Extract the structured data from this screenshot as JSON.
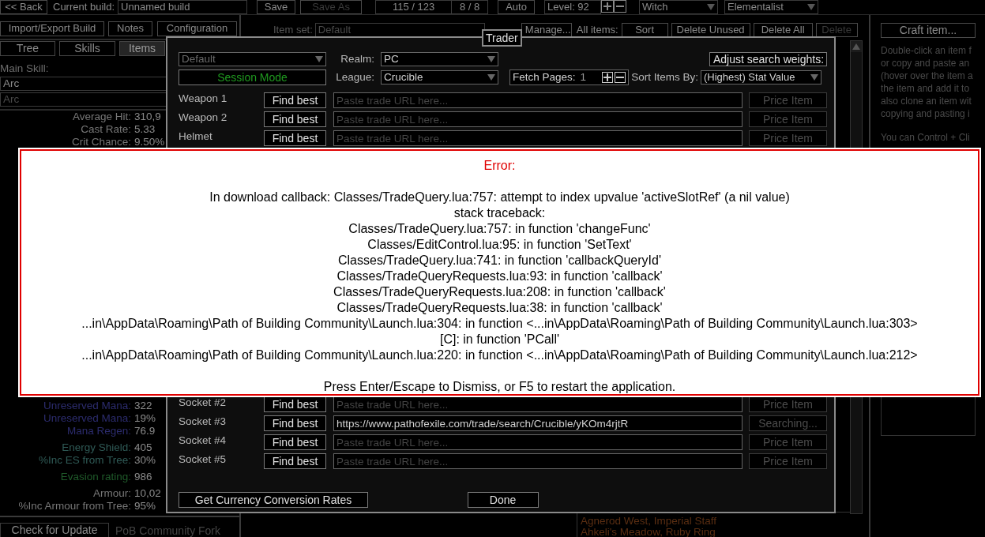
{
  "top_bar": {
    "back_button": "<< Back",
    "build_label": "Current build:",
    "build_name": "Unnamed build",
    "save_button": {
      "label": "Save",
      "disabled": false
    },
    "save_as_button": {
      "label": "Save As",
      "disabled": true
    },
    "passive_points": "115 / 123",
    "ascendancy_points": "8 / 8",
    "auto_button": "Auto",
    "level": "Level: 92",
    "class_dropdown": "Witch",
    "ascendancy_dropdown": "Elementalist"
  },
  "build_buttons": [
    "Import/Export Build",
    "Notes",
    "Configuration"
  ],
  "tabs": [
    {
      "label": "Tree",
      "selected": false
    },
    {
      "label": "Skills",
      "selected": false
    },
    {
      "label": "Items",
      "selected": true
    }
  ],
  "main_skill": {
    "label": "Main Skill:",
    "skill": {
      "value": "Arc",
      "disabled": false
    },
    "skill_part": {
      "value": "Arc",
      "disabled": true
    }
  },
  "stat_groups_upper": [
    {
      "stats": [
        {
          "label": "Average Hit:",
          "value": "310,9",
          "color": "#777777"
        },
        {
          "label": "Cast Rate:",
          "value": "5.33",
          "color": "#777777"
        },
        {
          "label": "Crit Chance:",
          "value": "9.50%",
          "color": "#777777"
        }
      ]
    }
  ],
  "stat_groups_lower": [
    {
      "stats": [
        {
          "label": "Unreserved Mana:",
          "value": "322",
          "color": "#2c2c6e"
        },
        {
          "label": "Unreserved Mana:",
          "value": "19%",
          "color": "#2c2c6e"
        },
        {
          "label": "Mana Regen:",
          "value": "76.9",
          "color": "#2c2c6e"
        }
      ]
    },
    {
      "stats": [
        {
          "label": "Energy Shield:",
          "value": "405",
          "color": "#2f5a56"
        },
        {
          "label": "%Inc ES from Tree:",
          "value": "30%",
          "color": "#2f5a56"
        }
      ]
    },
    {
      "stats": [
        {
          "label": "Evasion rating:",
          "value": "986",
          "color": "#1f5a2a"
        }
      ]
    },
    {
      "stats": [
        {
          "label": "Armour:",
          "value": "10,02",
          "color": "#777777"
        },
        {
          "label": "%Inc Armour from Tree:",
          "value": "95%",
          "color": "#777777"
        }
      ]
    }
  ],
  "footer": {
    "update_button": "Check for Update",
    "fork_label": "PoB Community Fork"
  },
  "items_toolbar": {
    "item_set_label": "Item set:",
    "item_set": "Default",
    "manage_button": "Manage...",
    "all_items_label": "All items:",
    "buttons": [
      {
        "label": "Sort",
        "disabled": false
      },
      {
        "label": "Delete Unused",
        "disabled": false
      },
      {
        "label": "Delete All",
        "disabled": false
      },
      {
        "label": "Delete",
        "disabled": true
      }
    ]
  },
  "item_list": [
    "Agnerod West, Imperial Staff",
    "Ahkeli's Meadow, Ruby Ring"
  ],
  "craft_panel": {
    "craft_button": "Craft item...",
    "help_text": [
      "Double-click an item f\nor copy and paste an\n(hover over the item a\nthe item and add it to\nalso clone an item wit\ncopying and pasting i",
      "You can Control + Cli"
    ]
  },
  "trader": {
    "title": "Trader",
    "preset": {
      "value": "Default",
      "disabled": true
    },
    "session_button": "Session Mode",
    "realm_label": "Realm:",
    "realm": "PC",
    "league_label": "League:",
    "league": "Crucible",
    "fetch_label": "Fetch Pages:",
    "fetch_value": "1",
    "weights_button": "Adjust search weights:",
    "sort_label": "Sort Items By:",
    "sort": "(Highest) Stat Value",
    "slots_upper": [
      {
        "label": "Weapon 1",
        "find_button": "Find best",
        "placeholder": "Paste trade URL here...",
        "price_button": {
          "label": "Price Item",
          "disabled": true
        }
      },
      {
        "label": "Weapon 2",
        "find_button": "Find best",
        "placeholder": "Paste trade URL here...",
        "price_button": {
          "label": "Price Item",
          "disabled": true
        }
      },
      {
        "label": "Helmet",
        "find_button": "Find best",
        "placeholder": "Paste trade URL here...",
        "price_button": {
          "label": "Price Item",
          "disabled": true
        }
      }
    ],
    "slots_lower": [
      {
        "label": "Socket #2",
        "find_button": "Find best",
        "placeholder": "Paste trade URL here...",
        "price_button": {
          "label": "Price Item",
          "disabled": true
        }
      },
      {
        "label": "Socket #3",
        "find_button": "Find best",
        "url": "https://www.pathofexile.com/trade/search/Crucible/yKOm4rjtR",
        "price_button": {
          "label": "Searching...",
          "disabled": true
        }
      },
      {
        "label": "Socket #4",
        "find_button": "Find best",
        "placeholder": "Paste trade URL here...",
        "price_button": {
          "label": "Price Item",
          "disabled": true
        }
      },
      {
        "label": "Socket #5",
        "find_button": "Find best",
        "placeholder": "Paste trade URL here...",
        "price_button": {
          "label": "Price Item",
          "disabled": true
        }
      }
    ],
    "currency_button": "Get Currency Conversion Rates",
    "done_button": "Done"
  },
  "error": {
    "title": "Error:",
    "lines": [
      "In download callback: Classes/TradeQuery.lua:757: attempt to index upvalue 'activeSlotRef' (a nil value)",
      "stack traceback:",
      "Classes/TradeQuery.lua:757: in function 'changeFunc'",
      "Classes/EditControl.lua:95: in function 'SetText'",
      "Classes/TradeQuery.lua:741: in function 'callbackQueryId'",
      "Classes/TradeQueryRequests.lua:93: in function 'callback'",
      "Classes/TradeQueryRequests.lua:208: in function 'callback'",
      "Classes/TradeQueryRequests.lua:38: in function 'callback'",
      "...in\\AppData\\Roaming\\Path of Building Community\\Launch.lua:304: in function <...in\\AppData\\Roaming\\Path of Building Community\\Launch.lua:303>",
      "[C]: in function 'PCall'",
      "...in\\AppData\\Roaming\\Path of Building Community\\Launch.lua:220: in function <...in\\AppData\\Roaming\\Path of Building Community\\Launch.lua:212>"
    ],
    "footer": "Press Enter/Escape to Dismiss, or F5 to restart the application."
  }
}
